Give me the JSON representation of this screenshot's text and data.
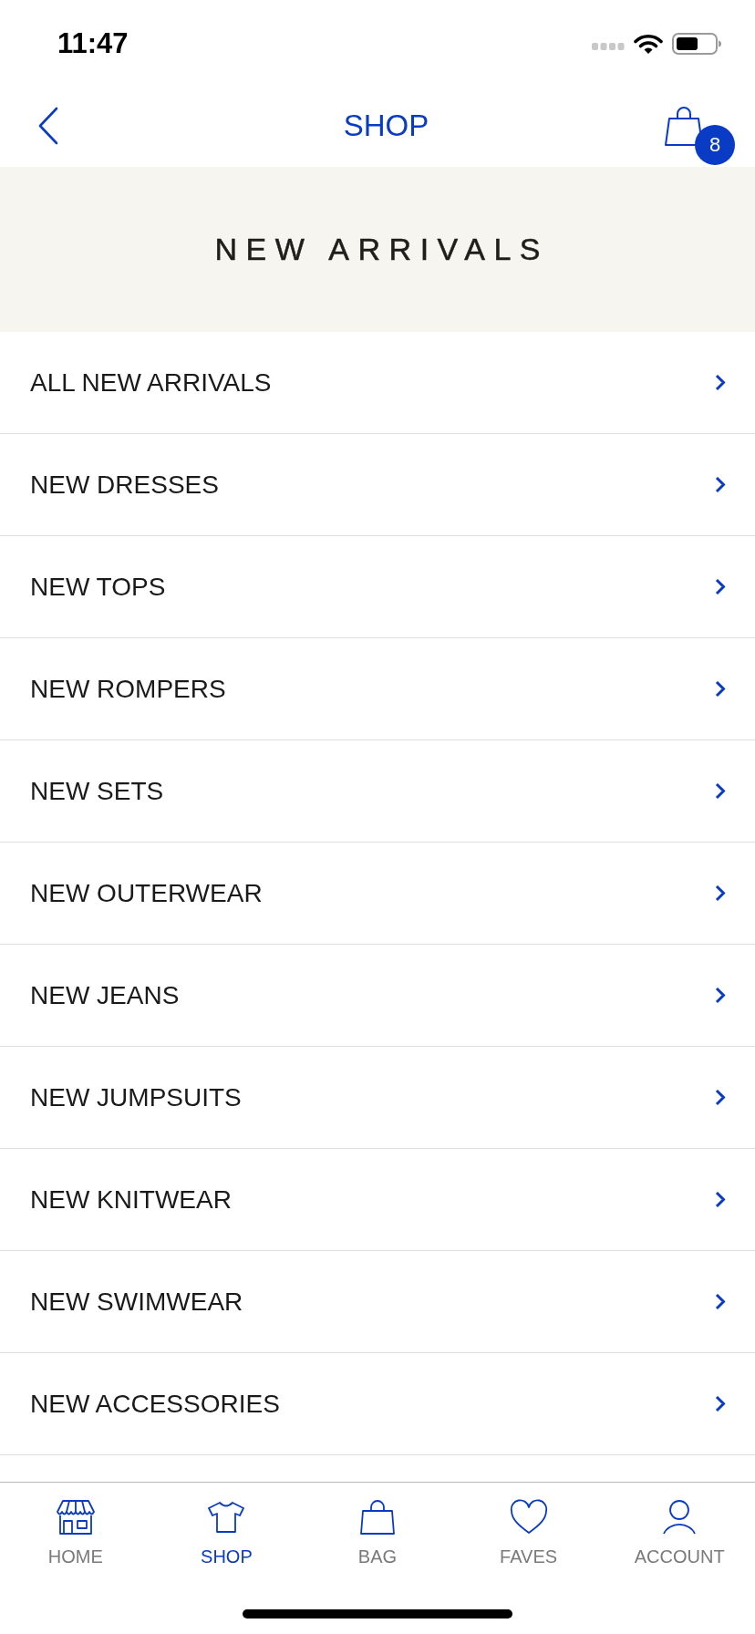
{
  "status_bar": {
    "time": "11:47"
  },
  "header": {
    "title": "SHOP",
    "cart_count": "8"
  },
  "banner": {
    "title": "NEW ARRIVALS"
  },
  "categories": [
    {
      "label": "ALL NEW ARRIVALS"
    },
    {
      "label": "NEW DRESSES"
    },
    {
      "label": "NEW TOPS"
    },
    {
      "label": "NEW ROMPERS"
    },
    {
      "label": "NEW SETS"
    },
    {
      "label": "NEW OUTERWEAR"
    },
    {
      "label": "NEW JEANS"
    },
    {
      "label": "NEW JUMPSUITS"
    },
    {
      "label": "NEW KNITWEAR"
    },
    {
      "label": "NEW SWIMWEAR"
    },
    {
      "label": "NEW ACCESSORIES"
    }
  ],
  "tab_bar": [
    {
      "label": "HOME",
      "selected": false
    },
    {
      "label": "SHOP",
      "selected": true
    },
    {
      "label": "BAG",
      "selected": false
    },
    {
      "label": "FAVES",
      "selected": false
    },
    {
      "label": "ACCOUNT",
      "selected": false
    }
  ]
}
